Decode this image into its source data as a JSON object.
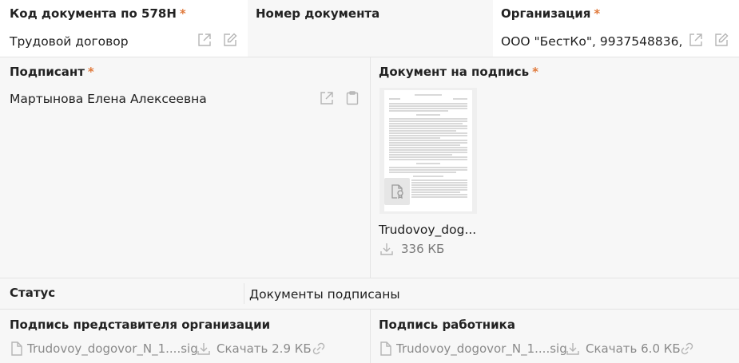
{
  "fields": {
    "doc_code": {
      "label": "Код документа по 578Н",
      "required": "*",
      "value": "Трудовой договор"
    },
    "doc_number": {
      "label": "Номер документа"
    },
    "organization": {
      "label": "Организация",
      "required": "*",
      "value": "ООО \"БестКо\", 9937548836,"
    },
    "signer": {
      "label": "Подписант",
      "required": "*",
      "value": "Мартынова Елена Алексеевна"
    },
    "document": {
      "label": "Документ на подпись",
      "required": "*",
      "file_name": "Trudovoy_dog...",
      "file_size": "336 КБ"
    },
    "status": {
      "label": "Статус",
      "value": "Документы подписаны"
    },
    "org_signature": {
      "label": "Подпись представителя организации",
      "file_name": "Trudovoy_dogovor_N_1....sig",
      "download": "Скачать 2.9 КБ"
    },
    "worker_signature": {
      "label": "Подпись работника",
      "file_name": "Trudovoy_dogovor_N_1....sig",
      "download": "Скачать 6.0 КБ"
    }
  },
  "icons": {
    "open": "external-link-icon",
    "edit": "edit-icon",
    "clipboard": "clipboard-icon",
    "file": "file-icon",
    "download": "download-icon",
    "link": "link-icon",
    "certificate": "certificate-icon"
  },
  "colors": {
    "required": "#e0793b",
    "icon": "#b5b5b5",
    "muted_text": "#8a8a8a"
  }
}
